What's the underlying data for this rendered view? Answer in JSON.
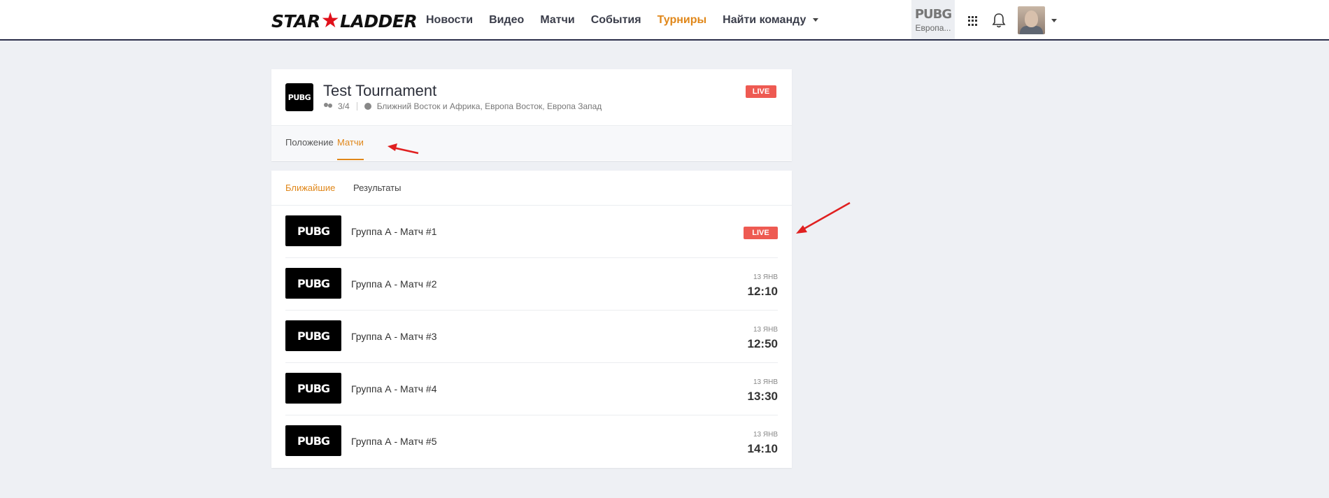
{
  "header": {
    "logo_left": "STAR",
    "logo_star": "★",
    "logo_right": "LADDER",
    "nav": [
      {
        "label": "Новости",
        "active": false
      },
      {
        "label": "Видео",
        "active": false
      },
      {
        "label": "Матчи",
        "active": false
      },
      {
        "label": "События",
        "active": false
      },
      {
        "label": "Турниры",
        "active": true
      },
      {
        "label": "Найти команду",
        "active": false
      }
    ],
    "game": {
      "name": "PUBG",
      "region": "Европа..."
    },
    "icons": [
      "apps-icon",
      "bell-icon",
      "avatar",
      "chevron-down-icon"
    ]
  },
  "tournament": {
    "logo": "PUBG",
    "title": "Test Tournament",
    "teams": "3/4",
    "regions": "Ближний Восток и Африка, Европа Восток, Европа Запад",
    "status": "LIVE",
    "tabs": [
      {
        "label": "Положение",
        "active": false
      },
      {
        "label": "Матчи",
        "active": true
      }
    ]
  },
  "matches": {
    "subtabs": [
      {
        "label": "Ближайшие",
        "active": true
      },
      {
        "label": "Результаты",
        "active": false
      }
    ],
    "rows": [
      {
        "logo": "PUBG",
        "name": "Группа А - Матч #1",
        "status": "LIVE"
      },
      {
        "logo": "PUBG",
        "name": "Группа А - Матч #2",
        "date": "13 ЯНВ",
        "time": "12:10"
      },
      {
        "logo": "PUBG",
        "name": "Группа А - Матч #3",
        "date": "13 ЯНВ",
        "time": "12:50"
      },
      {
        "logo": "PUBG",
        "name": "Группа А - Матч #4",
        "date": "13 ЯНВ",
        "time": "13:30"
      },
      {
        "logo": "PUBG",
        "name": "Группа А - Матч #5",
        "date": "13 ЯНВ",
        "time": "14:10"
      }
    ]
  },
  "colors": {
    "accent": "#e0871a",
    "live": "#ee5a52",
    "background": "#eef0f4",
    "annotation": "#e02020"
  }
}
